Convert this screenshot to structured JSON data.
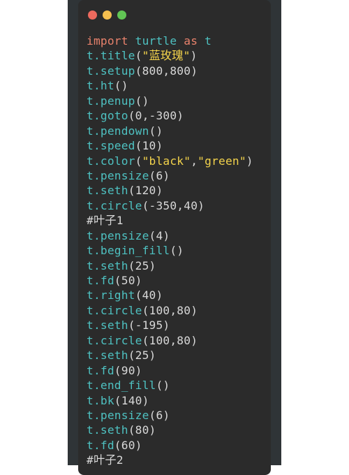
{
  "window": {
    "buttons": {
      "close_color": "#ed6a5e",
      "minimize_color": "#f5bf4f",
      "maximize_color": "#61c554"
    }
  },
  "colors": {
    "background": "#2b2b2b",
    "keyword": "#e8826c",
    "identifier": "#4ec1c1",
    "string": "#f2d24b",
    "plain": "#d8d8d8"
  },
  "code_lines": [
    {
      "tokens": [
        {
          "t": "import",
          "c": "kw"
        },
        {
          "t": " ",
          "c": "pun"
        },
        {
          "t": "turtle",
          "c": "mod"
        },
        {
          "t": " ",
          "c": "pun"
        },
        {
          "t": "as",
          "c": "kw"
        },
        {
          "t": " ",
          "c": "pun"
        },
        {
          "t": "t",
          "c": "var"
        }
      ]
    },
    {
      "tokens": [
        {
          "t": "t.title",
          "c": "fn"
        },
        {
          "t": "(",
          "c": "pun"
        },
        {
          "t": "\"蓝玫瑰\"",
          "c": "str"
        },
        {
          "t": ")",
          "c": "pun"
        }
      ]
    },
    {
      "tokens": [
        {
          "t": "t.setup",
          "c": "fn"
        },
        {
          "t": "(800,800)",
          "c": "num"
        }
      ]
    },
    {
      "tokens": [
        {
          "t": "t.ht",
          "c": "fn"
        },
        {
          "t": "()",
          "c": "pun"
        }
      ]
    },
    {
      "tokens": [
        {
          "t": "t.penup",
          "c": "fn"
        },
        {
          "t": "()",
          "c": "pun"
        }
      ]
    },
    {
      "tokens": [
        {
          "t": "t.goto",
          "c": "fn"
        },
        {
          "t": "(0,-300)",
          "c": "num"
        }
      ]
    },
    {
      "tokens": [
        {
          "t": "t.pendown",
          "c": "fn"
        },
        {
          "t": "()",
          "c": "pun"
        }
      ]
    },
    {
      "tokens": [
        {
          "t": "t.speed",
          "c": "fn"
        },
        {
          "t": "(10)",
          "c": "num"
        }
      ]
    },
    {
      "tokens": [
        {
          "t": "t.color",
          "c": "fn"
        },
        {
          "t": "(",
          "c": "pun"
        },
        {
          "t": "\"black\"",
          "c": "str"
        },
        {
          "t": ",",
          "c": "pun"
        },
        {
          "t": "\"green\"",
          "c": "str"
        },
        {
          "t": ")",
          "c": "pun"
        }
      ]
    },
    {
      "tokens": [
        {
          "t": "t.pensize",
          "c": "fn"
        },
        {
          "t": "(6)",
          "c": "num"
        }
      ]
    },
    {
      "tokens": [
        {
          "t": "t.seth",
          "c": "fn"
        },
        {
          "t": "(120)",
          "c": "num"
        }
      ]
    },
    {
      "tokens": [
        {
          "t": "t.circle",
          "c": "fn"
        },
        {
          "t": "(-350,40)",
          "c": "num"
        }
      ]
    },
    {
      "tokens": [
        {
          "t": "#叶子1",
          "c": "cmt"
        }
      ]
    },
    {
      "tokens": [
        {
          "t": "t.pensize",
          "c": "fn"
        },
        {
          "t": "(4)",
          "c": "num"
        }
      ]
    },
    {
      "tokens": [
        {
          "t": "t.begin_fill",
          "c": "fn"
        },
        {
          "t": "()",
          "c": "pun"
        }
      ]
    },
    {
      "tokens": [
        {
          "t": "t.seth",
          "c": "fn"
        },
        {
          "t": "(25)",
          "c": "num"
        }
      ]
    },
    {
      "tokens": [
        {
          "t": "t.fd",
          "c": "fn"
        },
        {
          "t": "(50)",
          "c": "num"
        }
      ]
    },
    {
      "tokens": [
        {
          "t": "t.right",
          "c": "fn"
        },
        {
          "t": "(40)",
          "c": "num"
        }
      ]
    },
    {
      "tokens": [
        {
          "t": "t.circle",
          "c": "fn"
        },
        {
          "t": "(100,80)",
          "c": "num"
        }
      ]
    },
    {
      "tokens": [
        {
          "t": "t.seth",
          "c": "fn"
        },
        {
          "t": "(-195)",
          "c": "num"
        }
      ]
    },
    {
      "tokens": [
        {
          "t": "t.circle",
          "c": "fn"
        },
        {
          "t": "(100,80)",
          "c": "num"
        }
      ]
    },
    {
      "tokens": [
        {
          "t": "t.seth",
          "c": "fn"
        },
        {
          "t": "(25)",
          "c": "num"
        }
      ]
    },
    {
      "tokens": [
        {
          "t": "t.fd",
          "c": "fn"
        },
        {
          "t": "(90)",
          "c": "num"
        }
      ]
    },
    {
      "tokens": [
        {
          "t": "t.end_fill",
          "c": "fn"
        },
        {
          "t": "()",
          "c": "pun"
        }
      ]
    },
    {
      "tokens": [
        {
          "t": "t.bk",
          "c": "fn"
        },
        {
          "t": "(140)",
          "c": "num"
        }
      ]
    },
    {
      "tokens": [
        {
          "t": "t.pensize",
          "c": "fn"
        },
        {
          "t": "(6)",
          "c": "num"
        }
      ]
    },
    {
      "tokens": [
        {
          "t": "t.seth",
          "c": "fn"
        },
        {
          "t": "(80)",
          "c": "num"
        }
      ]
    },
    {
      "tokens": [
        {
          "t": "t.fd",
          "c": "fn"
        },
        {
          "t": "(60)",
          "c": "num"
        }
      ]
    },
    {
      "tokens": [
        {
          "t": "#叶子2",
          "c": "cmt"
        }
      ]
    }
  ]
}
